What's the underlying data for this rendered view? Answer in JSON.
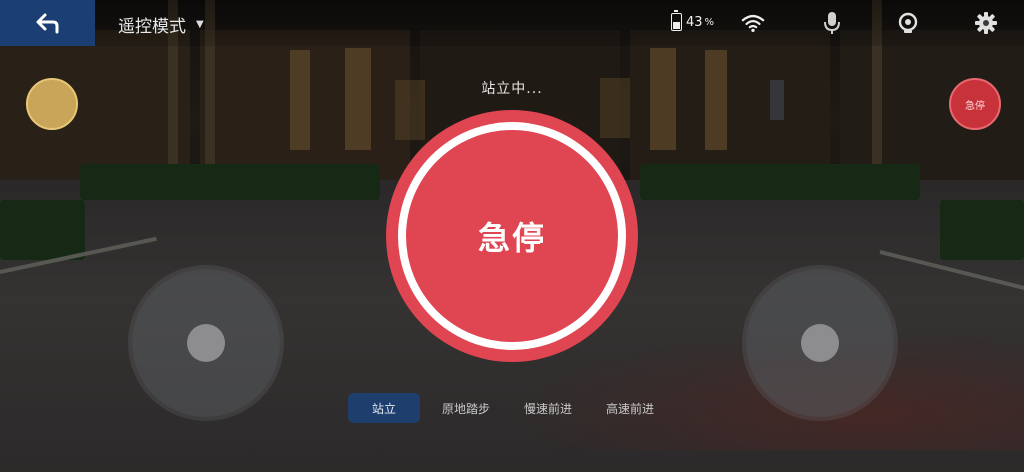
{
  "topbar": {
    "back_icon": "back-arrow-icon",
    "mode_label": "遥控模式",
    "battery_value": "43",
    "battery_unit": "%",
    "icons": [
      "wifi-icon",
      "microphone-icon",
      "camera-icon",
      "gear-icon"
    ]
  },
  "side_buttons": {
    "left_label": "",
    "right_label": "急停"
  },
  "status_text": "站立中...",
  "estop": {
    "label": "急停",
    "color": "#e04552"
  },
  "actions": [
    {
      "label": "站立",
      "active": true
    },
    {
      "label": "原地踏步",
      "active": false
    },
    {
      "label": "慢速前进",
      "active": false
    },
    {
      "label": "高速前进",
      "active": false
    }
  ],
  "colors": {
    "accent": "#1e3f6e",
    "danger": "#e04552",
    "warning": "#c9a559"
  }
}
